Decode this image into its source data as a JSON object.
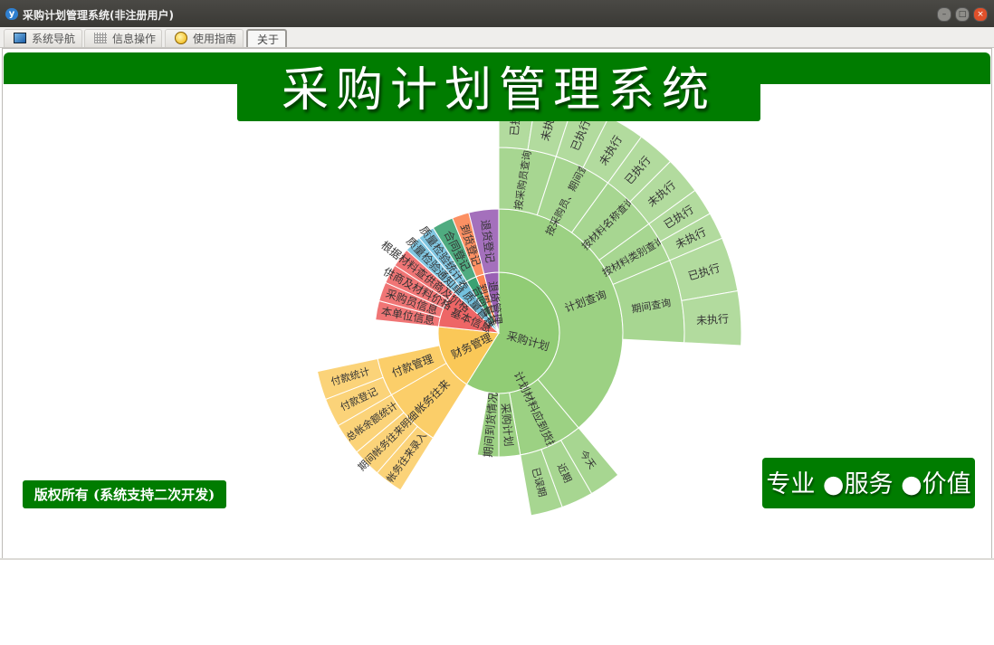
{
  "window": {
    "title": "采购计划管理系统(非注册用户)",
    "icon": "app-logo-icon",
    "controls": [
      "minimize",
      "maximize",
      "close"
    ]
  },
  "tabs": [
    {
      "label": "系统导航",
      "icon": "monitor-icon"
    },
    {
      "label": "信息操作",
      "icon": "grid-icon"
    },
    {
      "label": "使用指南",
      "icon": "guide-icon"
    },
    {
      "label": "关于",
      "selected": true
    }
  ],
  "banner": {
    "title": "采购计划管理系统"
  },
  "footer": {
    "copyright": "版权所有 (系统支持二次开发)",
    "slogan": "专业 ●服务 ●价值"
  },
  "colors": {
    "brand": "#007c00",
    "采购计划": "#91cc75",
    "财务管理": "#fac858",
    "基本信息": "#ee6666",
    "质量管理": "#73c0de",
    "合同管理": "#3ba272",
    "到货管理": "#fc8452",
    "退货管理": "#9a60b4"
  },
  "chart_data": {
    "type": "sunburst",
    "total": 360,
    "nodes": [
      {
        "name": "采购计划",
        "value": 212,
        "children": [
          {
            "name": "计划查询",
            "value": 140,
            "children": [
              {
                "name": "按采购员查询",
                "value": 18,
                "children": [
                  {
                    "name": "已执行",
                    "value": 9
                  },
                  {
                    "name": "未执行",
                    "value": 9
                  }
                ]
              },
              {
                "name": "按采购员、期间查询",
                "value": 18,
                "children": [
                  {
                    "name": "已执行",
                    "value": 9
                  },
                  {
                    "name": "未执行",
                    "value": 9
                  }
                ]
              },
              {
                "name": "按材料名称查询",
                "value": 18,
                "children": [
                  {
                    "name": "已执行",
                    "value": 9
                  },
                  {
                    "name": "未执行",
                    "value": 9
                  }
                ]
              },
              {
                "name": "按材料类别查询",
                "value": 13,
                "children": [
                  {
                    "name": "已执行",
                    "value": 6.5
                  },
                  {
                    "name": "未执行",
                    "value": 6.5
                  }
                ]
              },
              {
                "name": "期间查询",
                "value": 26,
                "children": [
                  {
                    "name": "已执行",
                    "value": 13
                  },
                  {
                    "name": "未执行",
                    "value": 13
                  }
                ]
              }
            ]
          },
          {
            "name": "计划材料应到货提示",
            "value": 30,
            "children": [
              {
                "name": "今天",
                "value": 10
              },
              {
                "name": "近期",
                "value": 10
              },
              {
                "name": "已误期",
                "value": 10
              }
            ]
          },
          {
            "name": "采购计划",
            "value": 10
          },
          {
            "name": "期间到货情况",
            "value": 10
          }
        ]
      },
      {
        "name": "财务管理",
        "value": 64,
        "children": [
          {
            "name": "帐务往来",
            "value": 28,
            "children": [
              {
                "name": "帐务往来录入",
                "value": 9
              },
              {
                "name": "期间帐务往来明细",
                "value": 9
              },
              {
                "name": "总帐余额统计",
                "value": 10
              }
            ]
          },
          {
            "name": "付款管理",
            "value": 18,
            "children": [
              {
                "name": "付款登记",
                "value": 9
              },
              {
                "name": "付款统计",
                "value": 9
              }
            ]
          }
        ]
      },
      {
        "name": "基本信息",
        "value": 36,
        "children": [
          {
            "name": "本单位信息",
            "value": 9
          },
          {
            "name": "采购员信息",
            "value": 9
          },
          {
            "name": "供商及材料价格",
            "value": 9
          },
          {
            "name": "根据材料查供商及价格",
            "value": 9
          }
        ]
      },
      {
        "name": "质量管理",
        "value": 16,
        "children": [
          {
            "name": "质量检验通知单",
            "value": 8
          },
          {
            "name": "质量检验统计表",
            "value": 8
          }
        ]
      },
      {
        "name": "合同管理",
        "value": 10,
        "children": [
          {
            "name": "合同登记",
            "value": 10
          }
        ]
      },
      {
        "name": "到货管理",
        "value": 8,
        "children": [
          {
            "name": "到货登记",
            "value": 8
          }
        ]
      },
      {
        "name": "退货管理",
        "value": 14,
        "children": [
          {
            "name": "退货登记",
            "value": 14
          }
        ]
      }
    ]
  }
}
